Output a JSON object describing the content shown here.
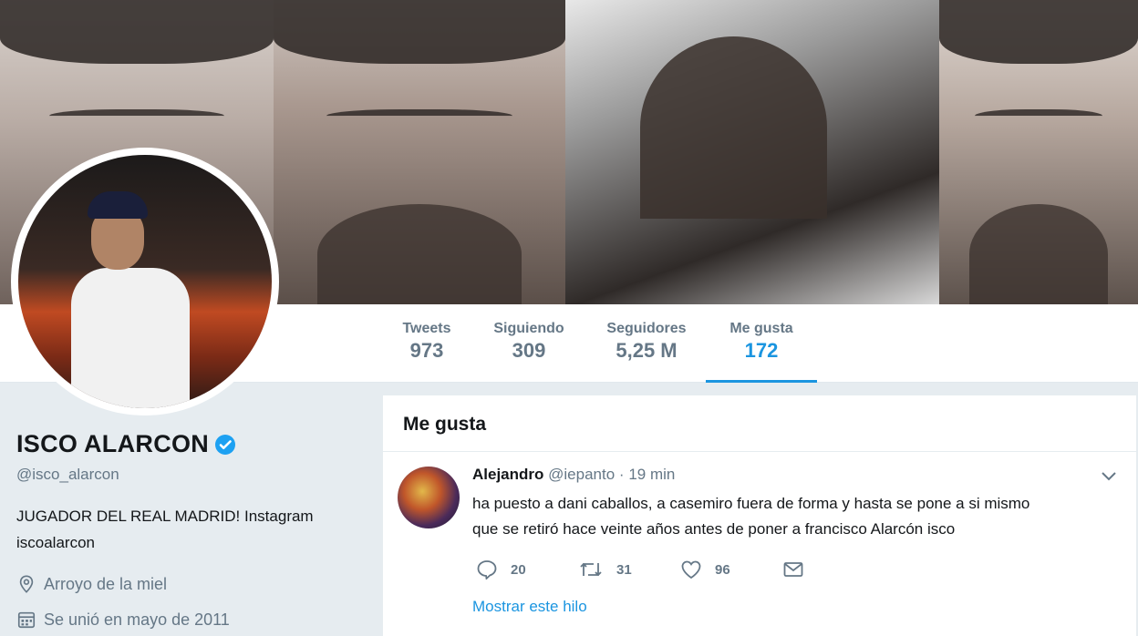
{
  "profile": {
    "name": "ISCO ALARCON",
    "verified": true,
    "handle": "@isco_alarcon",
    "bio": "JUGADOR DEL REAL MADRID! Instagram iscoalarcon",
    "location": "Arroyo de la miel",
    "joined": "Se unió en mayo de 2011"
  },
  "nav": {
    "tweets": {
      "label": "Tweets",
      "value": "973"
    },
    "following": {
      "label": "Siguiendo",
      "value": "309"
    },
    "followers": {
      "label": "Seguidores",
      "value": "5,25 M"
    },
    "likes": {
      "label": "Me gusta",
      "value": "172",
      "active": true
    }
  },
  "timeline": {
    "title": "Me gusta",
    "tweet": {
      "author": "Alejandro",
      "handle": "@iepanto",
      "separator": "·",
      "time": "19 min",
      "text_line1": "ha puesto a dani caballos, a casemiro fuera de forma y hasta se pone a si mismo",
      "text_line2": "que se retiró hace veinte años antes de poner a francisco Alarcón isco",
      "replies": "20",
      "retweets": "31",
      "likes": "96",
      "show_thread": "Mostrar este hilo"
    }
  },
  "colors": {
    "accent": "#1b95e0",
    "muted": "#657786",
    "background": "#e6ecf0",
    "verified": "#1da1f2"
  },
  "icons": [
    "verified-badge-icon",
    "location-icon",
    "calendar-icon",
    "reply-icon",
    "retweet-icon",
    "like-icon",
    "message-icon",
    "chevron-down-icon"
  ]
}
